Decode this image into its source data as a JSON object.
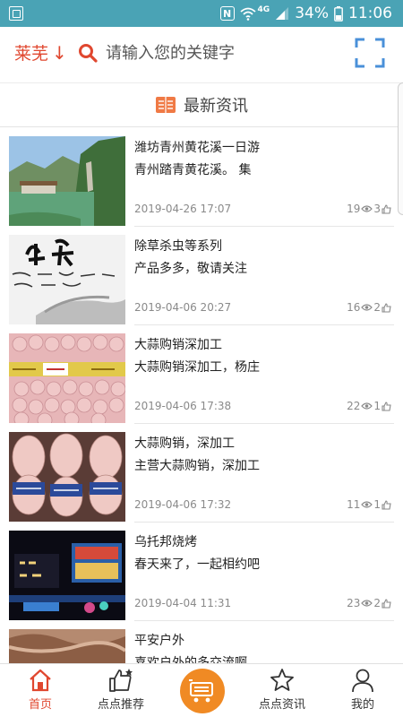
{
  "status_bar": {
    "signal_tag": "4G",
    "battery": "34%",
    "time": "11:06"
  },
  "header": {
    "city": "莱芜",
    "city_arrow": "↓",
    "search_placeholder": "请输入您的关键字"
  },
  "section": {
    "title": "最新资讯"
  },
  "news": [
    {
      "title": "潍坊青州黄花溪一日游",
      "summary": "青州踏青黄花溪。 集",
      "date": "2019-04-26 17:07",
      "views": "19",
      "likes": "3",
      "thumb": "landscape-lake"
    },
    {
      "title": "除草杀虫等系列",
      "summary": "产品多多，敬请关注",
      "date": "2019-04-06 20:27",
      "views": "16",
      "likes": "2",
      "thumb": "calligraphy-hands"
    },
    {
      "title": "大蒜购销深加工",
      "summary": "大蒜购销深加工，杨庄",
      "date": "2019-04-06 17:38",
      "views": "22",
      "likes": "1",
      "thumb": "garlic-bag"
    },
    {
      "title": "大蒜购销，深加工",
      "summary": "主营大蒜购销，深加工",
      "date": "2019-04-06 17:32",
      "views": "11",
      "likes": "1",
      "thumb": "garlic-sacks"
    },
    {
      "title": "乌托邦烧烤",
      "summary": "春天来了，一起相约吧",
      "date": "2019-04-04 11:31",
      "views": "23",
      "likes": "2",
      "thumb": "bbq-night"
    },
    {
      "title": "平安户外",
      "summary": "喜欢户外的多交流啊",
      "date": "",
      "views": "",
      "likes": "",
      "thumb": "rocks"
    }
  ],
  "tabs": [
    {
      "label": "首页",
      "icon": "home-icon",
      "active": true
    },
    {
      "label": "点点推荐",
      "icon": "thumbs-up-icon",
      "active": false
    },
    {
      "label": "",
      "icon": "shop-cart-icon",
      "active": false
    },
    {
      "label": "点点资讯",
      "icon": "star-icon",
      "active": false
    },
    {
      "label": "我的",
      "icon": "user-icon",
      "active": false
    }
  ],
  "colors": {
    "accent": "#e0472f",
    "status_bar": "#4aa3b5",
    "center_button": "#f08a24",
    "scan": "#4a90d9"
  }
}
